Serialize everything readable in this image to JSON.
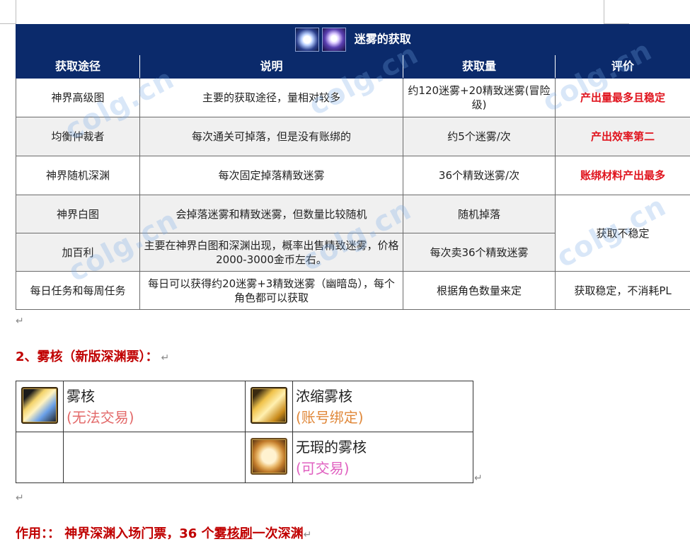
{
  "acquisition_table": {
    "title": "迷雾的获取",
    "headers": [
      "获取途径",
      "说明",
      "获取量",
      "评价"
    ],
    "rows": [
      {
        "route": "神界高级图",
        "desc": "主要的获取途径，量相对较多",
        "amount": "约120迷雾+20精致迷雾(冒险级)",
        "rating": "产出量最多且稳定"
      },
      {
        "route": "均衡仲裁者",
        "desc": "每次通关可掉落，但是没有账绑的",
        "amount": "约5个迷雾/次",
        "rating": "产出效率第二"
      },
      {
        "route": "神界随机深渊",
        "desc": "每次固定掉落精致迷雾",
        "amount": "36个精致迷雾/次",
        "rating": "账绑材料产出最多"
      },
      {
        "route": "神界白图",
        "desc": "会掉落迷雾和精致迷雾，但数量比较随机",
        "amount": "随机掉落",
        "rating": "获取不稳定"
      },
      {
        "route": "加百利",
        "desc": "主要在神界白图和深渊出现，概率出售精致迷雾，价格2000-3000金币左右。",
        "amount": "每次卖36个精致迷雾"
      },
      {
        "route": "每日任务和每周任务",
        "desc": "每日可以获得约20迷雾+3精致迷雾（幽暗岛），每个角色都可以获取",
        "amount": "根据角色数量来定",
        "rating": "获取稳定，不消耗PL"
      }
    ]
  },
  "section_heading": "2、雾核（新版深渊票）：",
  "items": [
    {
      "name": "雾核",
      "trade": "(无法交易)",
      "icon": "mist-core-icon",
      "trade_color": "#e36a6a"
    },
    {
      "name": "浓缩雾核",
      "trade": "(账号绑定)",
      "icon": "condensed-mist-core-icon",
      "trade_color": "#e0883a"
    },
    {
      "name": "无瑕的雾核",
      "trade": "(可交易)",
      "icon": "flawless-mist-core-icon",
      "trade_color": "#e060c0"
    }
  ],
  "usage": {
    "prefix": "作用：：",
    "part1": "神界深渊入场门票，36 个",
    "underlined": "雾核刷",
    "part2": "一次深渊"
  },
  "watermark": "colg.cn",
  "return_mark": "↵"
}
